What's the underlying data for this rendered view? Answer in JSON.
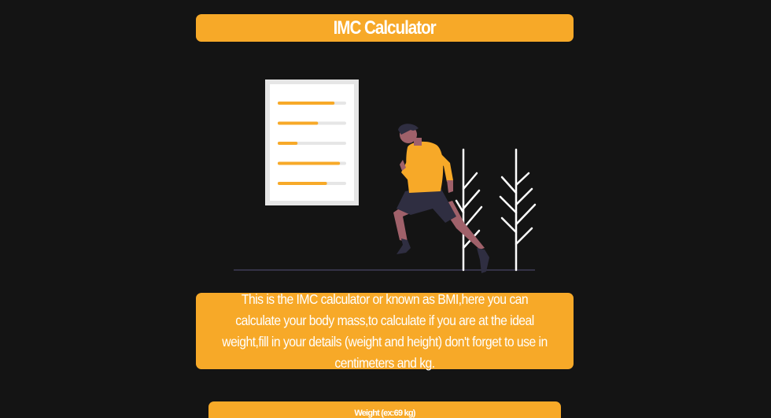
{
  "header": {
    "title": "IMC Calculator"
  },
  "illustration": {
    "icon": "runner-illustration",
    "accent_color": "#f7a928",
    "checklist_progress": [
      0.83,
      0.59,
      0.29,
      0.91,
      0.72
    ]
  },
  "description": {
    "text": "This is the IMC calculator or known as BMI,here you can calculate your body mass,to calculate if you are at the ideal weight,fill in your details (weight and height) don't forget to use in centimeters and kg."
  },
  "form": {
    "weight_label": "Weight (ex:69 kg)"
  },
  "colors": {
    "background": "#141414",
    "accent": "#f7a928",
    "text": "#ffffff"
  }
}
